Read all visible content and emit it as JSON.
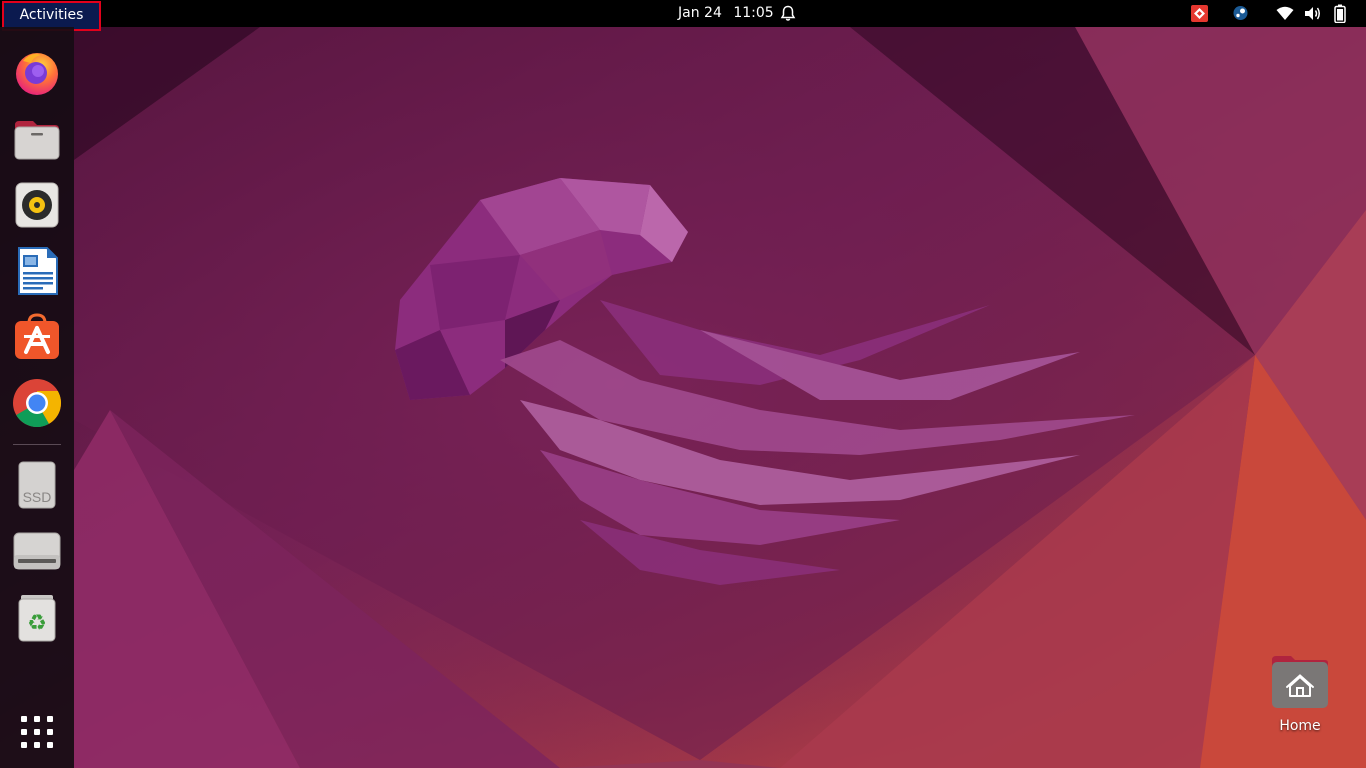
{
  "topbar": {
    "activities_label": "Activities",
    "date": "Jan 24",
    "time": "11:05",
    "notification_icon": "bell-icon",
    "tray_icons": [
      "anydesk-icon",
      "steam-icon",
      "wifi-icon",
      "volume-icon",
      "battery-icon"
    ]
  },
  "dock": {
    "items": [
      {
        "name": "firefox",
        "icon": "firefox-icon"
      },
      {
        "name": "files",
        "icon": "files-icon"
      },
      {
        "name": "rhythmbox",
        "icon": "speaker-icon"
      },
      {
        "name": "libreoffice-writer",
        "icon": "writer-document-icon"
      },
      {
        "name": "ubuntu-software",
        "icon": "app-store-icon"
      },
      {
        "name": "google-chrome",
        "icon": "chrome-icon"
      },
      {
        "name": "ssd-drive",
        "icon": "ssd-icon",
        "label": "SSD"
      },
      {
        "name": "hard-drive",
        "icon": "drive-icon"
      },
      {
        "name": "trash",
        "icon": "trash-icon",
        "glyph": "♻"
      }
    ],
    "show_apps_icon": "grid-icon"
  },
  "desktop": {
    "icons": [
      {
        "label": "Home",
        "icon": "home-folder-icon"
      }
    ]
  },
  "colors": {
    "activities_highlight": "#0b1a4f",
    "activities_border": "#e3001b",
    "topbar": "#000000",
    "wallpaper_base": "#7a2255",
    "jellyfish": "#8f2e80"
  }
}
